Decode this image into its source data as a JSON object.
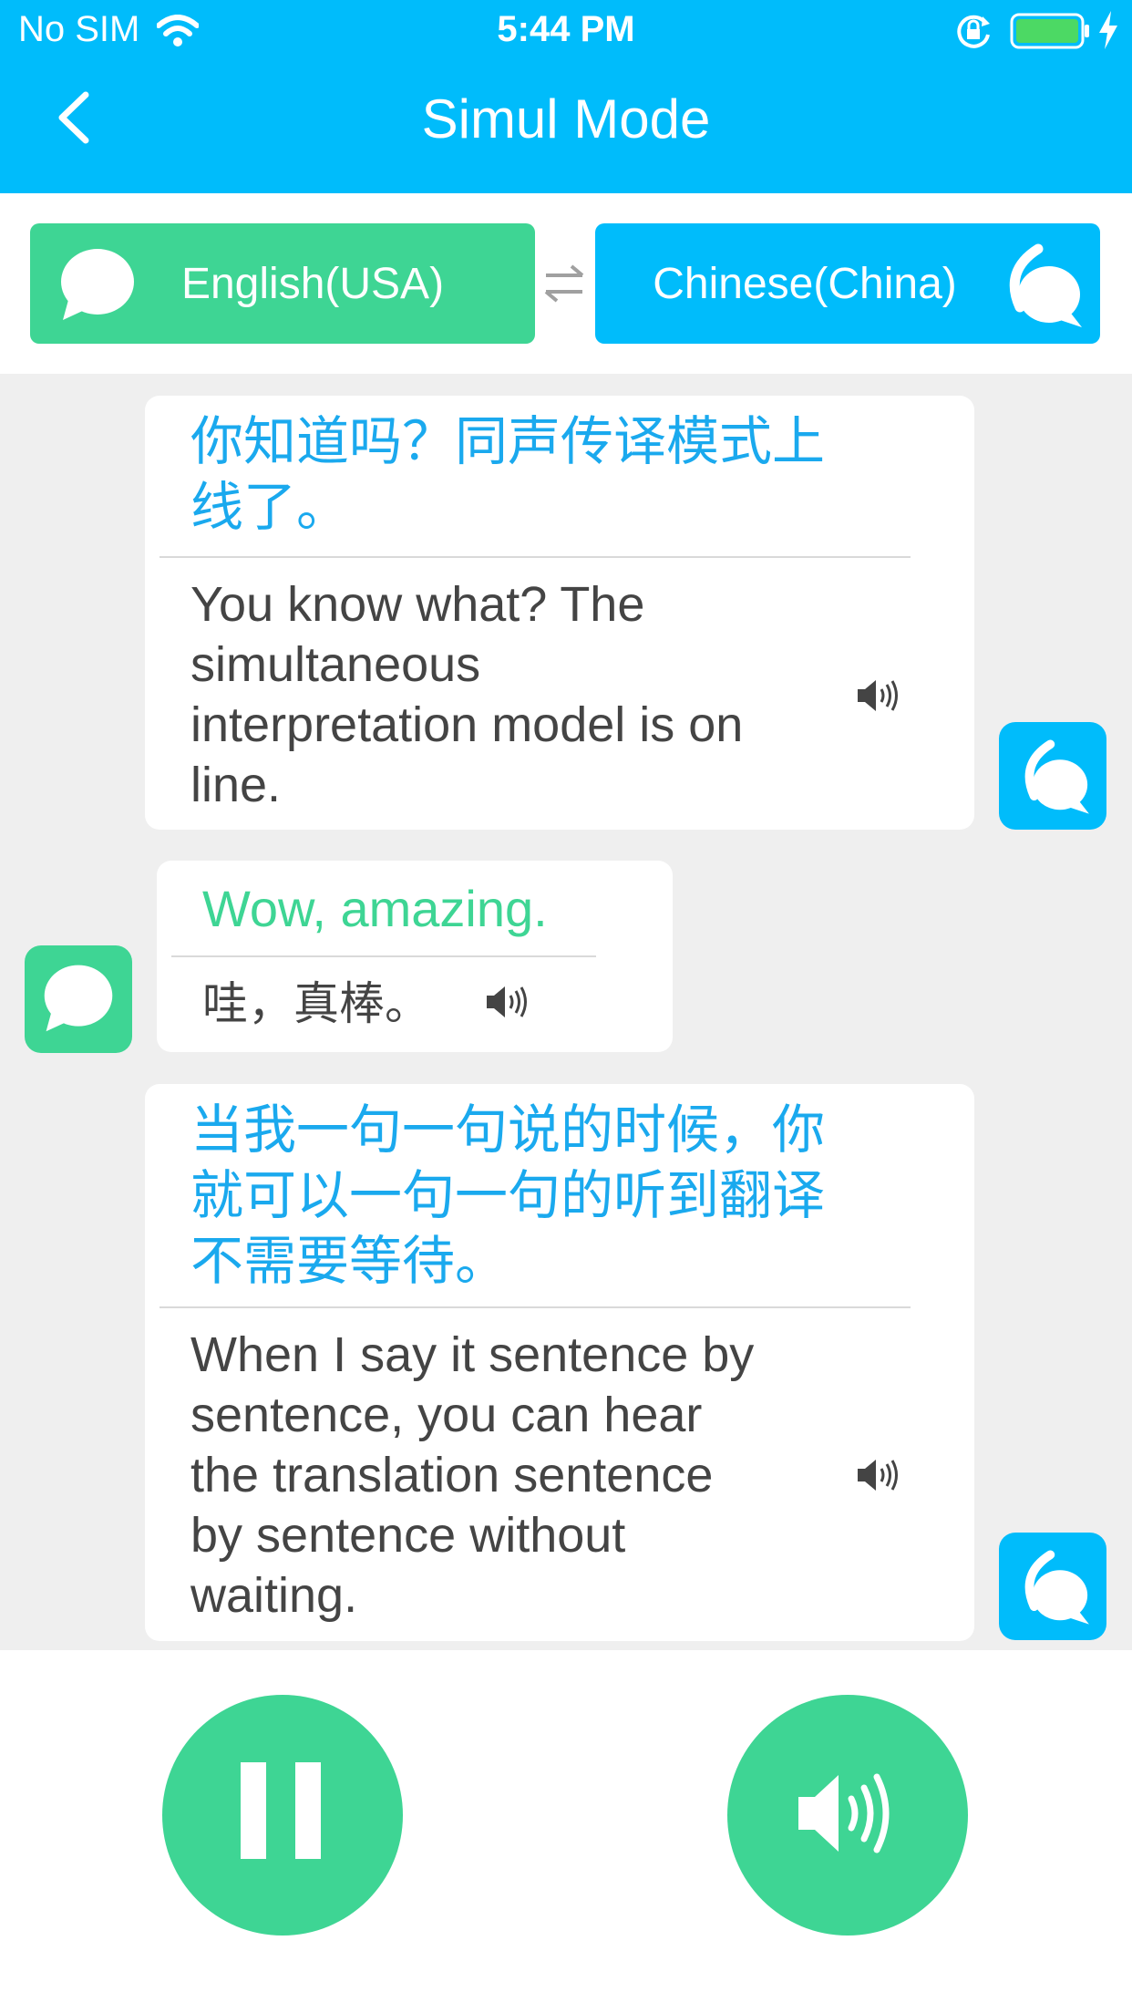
{
  "status_bar": {
    "carrier": "No SIM",
    "time": "5:44 PM"
  },
  "header": {
    "title": "Simul Mode",
    "back_icon": "chevron-left-icon"
  },
  "languages": {
    "source": {
      "label": "English(USA)",
      "icon": "chat-bubble-icon",
      "color": "#3ed594"
    },
    "swap_icon": "swap-arrows-icon",
    "target": {
      "label": "Chinese(China)",
      "icon": "chat-bubble-wave-icon",
      "color": "#00bcfb"
    }
  },
  "messages": [
    {
      "side": "right",
      "source": "你知道吗？同声传译模式上线了。",
      "source_lines": [
        "你知道吗？同声传译模式上",
        "线了。"
      ],
      "translation": "You know what? The simultaneous interpretation model is on line.",
      "translation_lines": [
        "You know what? The",
        "simultaneous",
        "interpretation model is on",
        "line."
      ]
    },
    {
      "side": "left",
      "source": "Wow, amazing.",
      "translation": "哇，真棒。"
    },
    {
      "side": "right",
      "source": "当我一句一句说的时候，你就可以一句一句的听到翻译不需要等待。",
      "source_lines": [
        "当我一句一句说的时候，你",
        "就可以一句一句的听到翻译",
        "不需要等待。"
      ],
      "translation": "When I say it sentence by sentence, you can hear the translation sentence by sentence without waiting.",
      "translation_lines": [
        "When I say it sentence by",
        "sentence, you can hear",
        "the translation sentence",
        "by sentence without",
        "waiting."
      ]
    }
  ],
  "controls": {
    "pause_icon": "pause-icon",
    "speaker_icon": "speaker-icon"
  },
  "colors": {
    "primary_blue": "#00bcfb",
    "primary_green": "#3ed594",
    "chat_background": "#efefef"
  }
}
